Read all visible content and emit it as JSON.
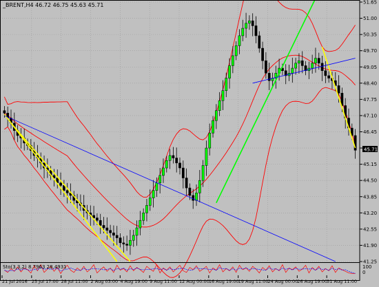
{
  "chart_data": {
    "type": "candlestick",
    "symbol_header": "_BRENT,H4 46.72 46.75 45.63 45.71",
    "x_labels": [
      "21 Jul 2016",
      "25 Jul 17:00",
      "28 Jul 11:00",
      "2 Aug 03:00",
      "4 Aug 19:00",
      "9 Aug 11:00",
      "12 Aug 00:00",
      "16 Aug 19:00",
      "19 Aug 11:00",
      "24 Aug 00:00",
      "26 Aug 19:00",
      "31 Aug 11:00"
    ],
    "y_ticks": [
      51.65,
      51.0,
      50.35,
      49.7,
      49.05,
      48.4,
      47.75,
      47.1,
      46.45,
      45.8,
      45.15,
      44.5,
      43.85,
      43.2,
      42.55,
      41.9,
      41.25
    ],
    "ylim": [
      41.25,
      51.65
    ],
    "current_price_label": "45.71",
    "close_series": [
      47.2,
      47.0,
      46.8,
      46.5,
      46.3,
      46.2,
      46.0,
      45.9,
      45.7,
      45.5,
      45.4,
      45.2,
      45.0,
      44.9,
      44.7,
      44.6,
      44.4,
      44.3,
      44.1,
      44.0,
      43.9,
      43.7,
      43.6,
      43.5,
      43.3,
      43.2,
      43.1,
      43.0,
      42.9,
      42.7,
      42.6,
      42.5,
      42.4,
      42.3,
      42.2,
      42.0,
      41.95,
      41.9,
      42.1,
      42.3,
      42.6,
      42.9,
      43.2,
      43.5,
      43.8,
      44.1,
      44.4,
      44.7,
      45.0,
      45.3,
      45.5,
      45.4,
      45.2,
      45.0,
      44.6,
      44.2,
      43.9,
      43.7,
      44.0,
      44.5,
      45.1,
      45.8,
      46.4,
      46.9,
      47.3,
      47.7,
      48.1,
      48.6,
      49.1,
      49.5,
      49.9,
      50.3,
      50.6,
      50.8,
      50.9,
      50.7,
      50.3,
      49.8,
      49.3,
      48.8,
      48.5,
      48.6,
      48.8,
      49.0,
      48.9,
      48.7,
      48.8,
      49.0,
      49.2,
      49.3,
      49.1,
      48.9,
      49.0,
      49.2,
      49.4,
      49.2,
      48.9,
      48.7,
      48.6,
      48.5,
      48.3,
      48.0,
      47.5,
      47.0,
      46.6,
      46.3,
      45.71
    ],
    "bands": {
      "color": "#ff0000",
      "middle_color": "#ff0000"
    },
    "trend_lines": [
      {
        "color": "#ffff00",
        "from": [
          0,
          47.15
        ],
        "to": [
          34,
          41.25
        ]
      },
      {
        "color": "#ffff00",
        "from": [
          2,
          46.8
        ],
        "to": [
          38,
          41.25
        ]
      },
      {
        "color": "#00ff00",
        "from": [
          64,
          43.6
        ],
        "to": [
          94,
          51.8
        ]
      },
      {
        "color": "#ffff00",
        "from": [
          96,
          49.85
        ],
        "to": [
          106,
          45.8
        ]
      },
      {
        "color": "#0000ff",
        "from": [
          0,
          47.1
        ],
        "to": [
          100,
          41.25
        ]
      },
      {
        "color": "#0000ff",
        "from": [
          75,
          48.4
        ],
        "to": [
          106,
          49.4
        ]
      }
    ],
    "oscillator": {
      "label": "Sto(3,3,2) 8.7963 28.4931",
      "top_label": "100",
      "bottom_label": "0",
      "series": [
        {
          "name": "main",
          "color": "#ff0000"
        },
        {
          "name": "signal",
          "color": "#0000ff"
        }
      ],
      "k_values": [
        40,
        20,
        55,
        30,
        70,
        25,
        60,
        45,
        15,
        80,
        35,
        90,
        20,
        50,
        75,
        30,
        65,
        10,
        55,
        85,
        40,
        20,
        60,
        35,
        75,
        25,
        50,
        90,
        15,
        45,
        70,
        30,
        60,
        20,
        85,
        40,
        55,
        25,
        80,
        35,
        65,
        45,
        20,
        75,
        50,
        30,
        90,
        15,
        60,
        40,
        70,
        25,
        55,
        85,
        35,
        20,
        65,
        45,
        80,
        30,
        50,
        75,
        15,
        60,
        40,
        90,
        25,
        55,
        35,
        70,
        20,
        85,
        45,
        60,
        30,
        75,
        50,
        15,
        65,
        40,
        80,
        25,
        55,
        35,
        90,
        20,
        60,
        45,
        70,
        30,
        50,
        85,
        15,
        65,
        40,
        75,
        25,
        55,
        35,
        80,
        20,
        60,
        45,
        30,
        15,
        10,
        9
      ]
    },
    "colors": {
      "background": "#c0c0c0",
      "bull_candle": "#00ff00",
      "bear_candle": "#000000",
      "grid": "#9a9a9a",
      "axis": "#000000",
      "price_label_bg": "#000000",
      "price_label_fg": "#ffffff"
    },
    "grid": true
  }
}
